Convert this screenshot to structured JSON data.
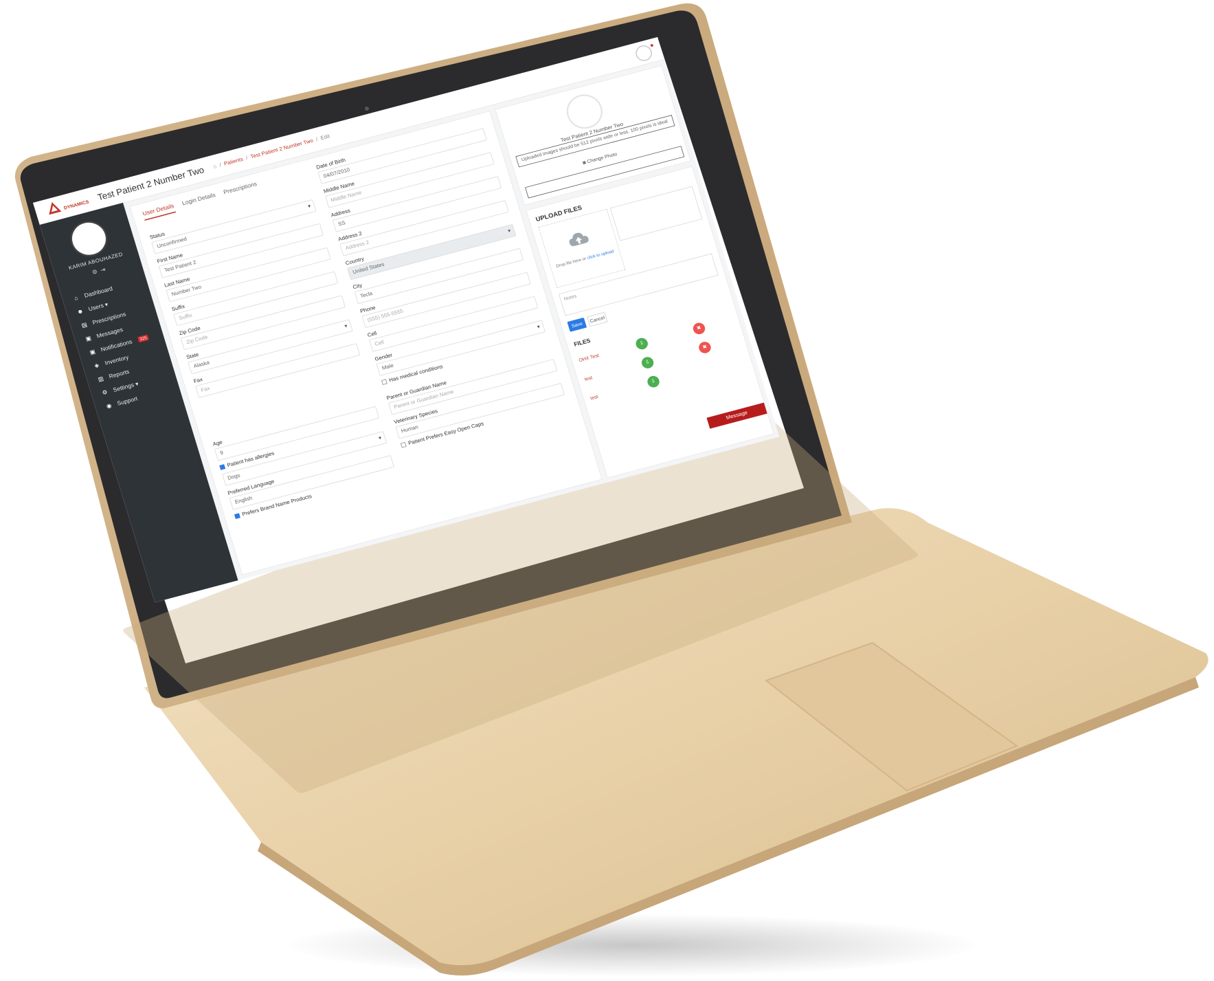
{
  "app": {
    "brand": "DYNAMICS",
    "page_title": "Test Patient 2 Number Two",
    "breadcrumb": [
      "Patients",
      "Test Patient 2 Number Two",
      "Edit"
    ]
  },
  "sidebar": {
    "user_name": "KARIM ABOUHAZED",
    "items": [
      {
        "label": "Dashboard",
        "icon": "home-icon"
      },
      {
        "label": "Users ▾",
        "icon": "users-icon"
      },
      {
        "label": "Prescriptions",
        "icon": "file-icon"
      },
      {
        "label": "Messages",
        "icon": "message-icon"
      },
      {
        "label": "Notifications",
        "icon": "bell-icon",
        "badge": "325"
      },
      {
        "label": "Inventory",
        "icon": "box-icon"
      },
      {
        "label": "Reports",
        "icon": "report-icon"
      },
      {
        "label": "Settings ▾",
        "icon": "gear-icon"
      },
      {
        "label": "Support",
        "icon": "support-icon"
      }
    ]
  },
  "tabs": [
    "User Details",
    "Login Details",
    "Prescriptions"
  ],
  "form": {
    "status": {
      "label": "Status",
      "value": "Unconfirmed"
    },
    "first_name": {
      "label": "First Name",
      "value": "Test Patient 2"
    },
    "last_name": {
      "label": "Last Name",
      "value": "Number Two"
    },
    "suffix": {
      "label": "Suffix",
      "placeholder": "Suffix"
    },
    "zip_code": {
      "label": "Zip Code",
      "placeholder": "Zip Code"
    },
    "state": {
      "label": "State",
      "value": "Alaska"
    },
    "fax": {
      "label": "Fax",
      "placeholder": "Fax"
    },
    "age": {
      "label": "Age",
      "value": "9"
    },
    "allergies": {
      "label": "Patient has allergies"
    },
    "allergy_value": "Dogs",
    "preferred_language": {
      "label": "Preferred Language",
      "value": "English"
    },
    "brand_name": {
      "label": "Prefers Brand Name Products"
    },
    "dob": {
      "label": "Date of Birth",
      "value": "04/07/2010"
    },
    "middle_name": {
      "label": "Middle Name",
      "placeholder": "Middle Name"
    },
    "address": {
      "label": "Address",
      "value": "SS"
    },
    "address2": {
      "label": "Address 2",
      "placeholder": "Address 2"
    },
    "country": {
      "label": "Country",
      "value": "United States"
    },
    "city": {
      "label": "City",
      "value": "Tecla"
    },
    "phone": {
      "label": "Phone",
      "placeholder": "(555) 555-5555"
    },
    "cell": {
      "label": "Cell",
      "placeholder": "Cell"
    },
    "gender": {
      "label": "Gender",
      "value": "Male"
    },
    "medical_conditions": {
      "label": "Has medical conditions"
    },
    "guardian": {
      "label": "Parent or Guardian Name",
      "placeholder": "Parent or Guardian Name"
    },
    "species": {
      "label": "Veterinary Species",
      "value": "Human"
    },
    "easy_open": {
      "label": "Patient Prefers Easy Open Caps"
    }
  },
  "photo_card": {
    "name": "Test Patient 2 Number Two",
    "hint": "Uploaded images should be 512 pixels wide or less. 100 pixels is ideal",
    "change_label": "Change Photo"
  },
  "upload": {
    "title": "UPLOAD FILES",
    "drop_text": "Drop file here or",
    "drop_link": "click to upload",
    "notes_placeholder": "Notes",
    "save_label": "Save",
    "cancel_label": "Cancel",
    "files_title": "FILES",
    "files": [
      "OHX Test",
      "test",
      "test"
    ],
    "message_label": "Message"
  },
  "colors": {
    "accent": "#c0392b",
    "sidebar": "#2e3338",
    "primary": "#2c7be5",
    "success": "#4caf50",
    "danger": "#ef5350",
    "laptop_body": "#e6cfa8"
  }
}
